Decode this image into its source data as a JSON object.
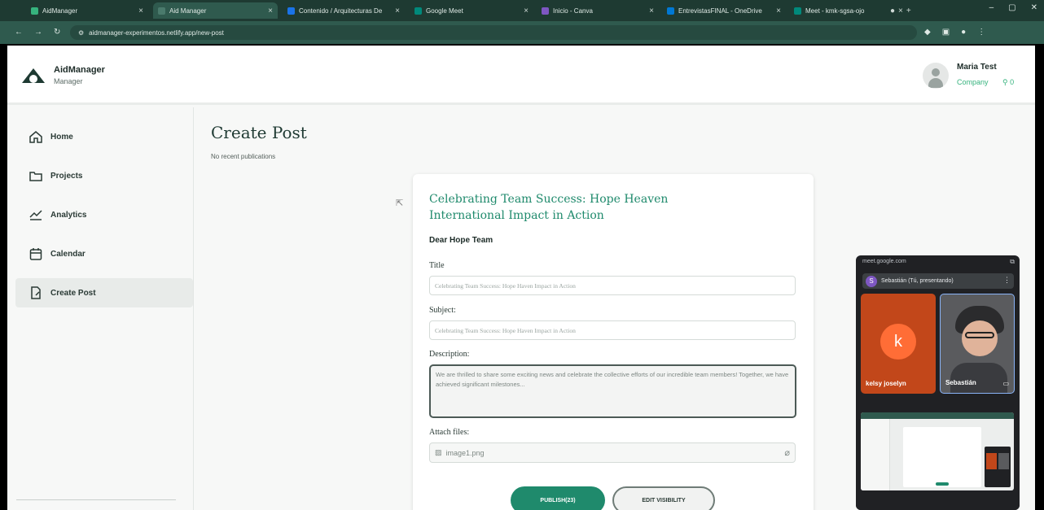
{
  "browser": {
    "tabs": [
      {
        "title": "AidManager",
        "favicon_color": "#36b37e"
      },
      {
        "title": "Aid Manager",
        "favicon_color": "#2f5a4e"
      },
      {
        "title": "Contenido / Arquitecturas De",
        "favicon_color": "#1a73e8"
      },
      {
        "title": "Google Meet",
        "favicon_color": "#00897b"
      },
      {
        "title": "Inicio - Canva",
        "favicon_color": "#7e57c2"
      },
      {
        "title": "EntrevistasFINAL - OneDrive",
        "favicon_color": "#0078d4"
      },
      {
        "title": "Meet - kmk-sgsa-ojo",
        "favicon_color": "#00897b"
      }
    ],
    "url": "aidmanager-experimentos.netlify.app/new-post"
  },
  "header": {
    "brand_name": "AidManager",
    "brand_role": "Manager",
    "user_name": "Maria Test",
    "user_company": "Company",
    "user_count": "0"
  },
  "sidebar": {
    "items": [
      {
        "label": "Home",
        "icon": "home-icon"
      },
      {
        "label": "Projects",
        "icon": "folder-icon"
      },
      {
        "label": "Analytics",
        "icon": "chart-line-icon"
      },
      {
        "label": "Calendar",
        "icon": "calendar-icon"
      },
      {
        "label": "Create Post",
        "icon": "post-icon",
        "active": true
      }
    ]
  },
  "main": {
    "title": "Create Post",
    "subtitle": "No recent publications"
  },
  "post": {
    "heading": "Celebrating Team Success: Hope Heaven International Impact in Action",
    "greeting": "Dear Hope Team",
    "title_label": "Title",
    "title_value": "Celebrating Team Success: Hope Haven Impact in Action",
    "subject_label": "Subject:",
    "subject_value": "Celebrating Team Success: Hope Haven Impact in Action",
    "description_label": "Description:",
    "description_value": "We are thrilled to share some exciting news and celebrate the collective efforts of our incredible team members! Together, we have achieved significant milestones...",
    "attach_label": "Attach files:",
    "attach_file": "image1.png",
    "publish_label": "PUBLISH(23)",
    "visibility_label": "EDIT VISIBILITY"
  },
  "meet": {
    "url": "meet.google.com",
    "presenter": "Sebastián (Tú, presentando)",
    "presenter_initial": "S",
    "participant1_initial": "k",
    "participant1_name": "kelsy joselyn",
    "participant2_name": "Sebastián"
  },
  "colors": {
    "brand_dark": "#1e3a32",
    "accent_green": "#1f8a6c",
    "company_green": "#36b37e"
  }
}
